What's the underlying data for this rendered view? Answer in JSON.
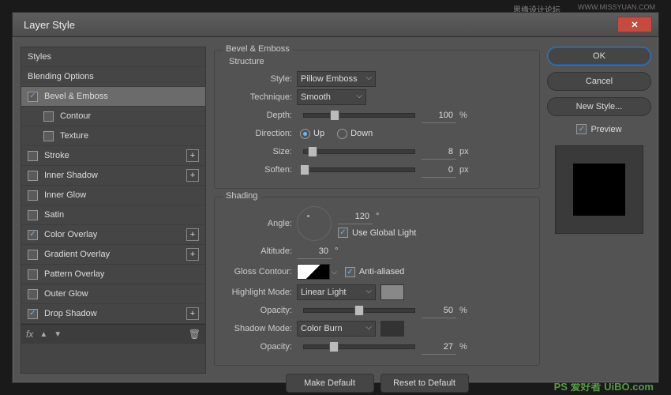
{
  "dialog_title": "Layer Style",
  "sidebar": {
    "items": [
      {
        "label": "Styles",
        "checked": null,
        "selected": false,
        "indent": false,
        "plus": false
      },
      {
        "label": "Blending Options",
        "checked": null,
        "selected": false,
        "indent": false,
        "plus": false
      },
      {
        "label": "Bevel & Emboss",
        "checked": true,
        "selected": true,
        "indent": false,
        "plus": false
      },
      {
        "label": "Contour",
        "checked": false,
        "selected": false,
        "indent": true,
        "plus": false
      },
      {
        "label": "Texture",
        "checked": false,
        "selected": false,
        "indent": true,
        "plus": false
      },
      {
        "label": "Stroke",
        "checked": false,
        "selected": false,
        "indent": false,
        "plus": true
      },
      {
        "label": "Inner Shadow",
        "checked": false,
        "selected": false,
        "indent": false,
        "plus": true
      },
      {
        "label": "Inner Glow",
        "checked": false,
        "selected": false,
        "indent": false,
        "plus": false
      },
      {
        "label": "Satin",
        "checked": false,
        "selected": false,
        "indent": false,
        "plus": false
      },
      {
        "label": "Color Overlay",
        "checked": true,
        "selected": false,
        "indent": false,
        "plus": true
      },
      {
        "label": "Gradient Overlay",
        "checked": false,
        "selected": false,
        "indent": false,
        "plus": true
      },
      {
        "label": "Pattern Overlay",
        "checked": false,
        "selected": false,
        "indent": false,
        "plus": false
      },
      {
        "label": "Outer Glow",
        "checked": false,
        "selected": false,
        "indent": false,
        "plus": false
      },
      {
        "label": "Drop Shadow",
        "checked": true,
        "selected": false,
        "indent": false,
        "plus": true
      }
    ]
  },
  "panel_title": "Bevel & Emboss",
  "structure_title": "Structure",
  "shading_title": "Shading",
  "fields": {
    "style_label": "Style:",
    "style_value": "Pillow Emboss",
    "technique_label": "Technique:",
    "technique_value": "Smooth",
    "depth_label": "Depth:",
    "depth_value": "100",
    "depth_unit": "%",
    "direction_label": "Direction:",
    "direction_up": "Up",
    "direction_down": "Down",
    "direction": "up",
    "size_label": "Size:",
    "size_value": "8",
    "size_unit": "px",
    "soften_label": "Soften:",
    "soften_value": "0",
    "soften_unit": "px",
    "angle_label": "Angle:",
    "angle_value": "120",
    "angle_unit": "°",
    "global_light_label": "Use Global Light",
    "global_light": true,
    "altitude_label": "Altitude:",
    "altitude_value": "30",
    "altitude_unit": "°",
    "gloss_contour_label": "Gloss Contour:",
    "anti_aliased_label": "Anti-aliased",
    "anti_aliased": true,
    "highlight_mode_label": "Highlight Mode:",
    "highlight_mode_value": "Linear Light",
    "opacity1_label": "Opacity:",
    "opacity1_value": "50",
    "opacity1_unit": "%",
    "shadow_mode_label": "Shadow Mode:",
    "shadow_mode_value": "Color Burn",
    "opacity2_label": "Opacity:",
    "opacity2_value": "27",
    "opacity2_unit": "%"
  },
  "buttons": {
    "ok": "OK",
    "cancel": "Cancel",
    "new_style": "New Style...",
    "preview": "Preview",
    "make_default": "Make Default",
    "reset_default": "Reset to Default"
  },
  "watermarks": {
    "top": "思缘设计论坛",
    "url": "WWW.MISSYUAN.COM",
    "bottom": "PS 爱好者     UiBO.com"
  }
}
